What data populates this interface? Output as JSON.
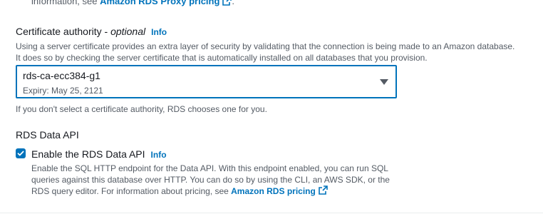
{
  "proxy_note": {
    "text_prefix": "information, see ",
    "link_label": "Amazon RDS Proxy pricing",
    "suffix": "."
  },
  "certificate_authority": {
    "label": "Certificate authority",
    "optional": "optional",
    "separator": " - ",
    "info": "Info",
    "description_line1": "Using a server certificate provides an extra layer of security by validating that the connection is being made to an Amazon database.",
    "description_line2": "It does so by checking the server certificate that is automatically installed on all databases that you provision.",
    "selected_value": "rds-ca-ecc384-g1",
    "selected_expiry": "Expiry: May 25, 2121",
    "hint": "If you don't select a certificate authority, RDS chooses one for you."
  },
  "data_api": {
    "section_title": "RDS Data API",
    "checkbox_label": "Enable the RDS Data API",
    "checked": true,
    "info": "Info",
    "description_line1": "Enable the SQL HTTP endpoint for the Data API. With this endpoint enabled, you can run SQL",
    "description_line2": "queries against this database over HTTP. You can do so by using the CLI, an AWS SDK, or the",
    "description_line3_prefix": "RDS query editor. For information about pricing, see ",
    "pricing_link": "Amazon RDS pricing"
  },
  "colors": {
    "link": "#0073bb",
    "text": "#16191f",
    "secondary": "#545b64"
  },
  "icons": [
    "external-link-icon",
    "chevron-down-icon",
    "check-icon"
  ]
}
